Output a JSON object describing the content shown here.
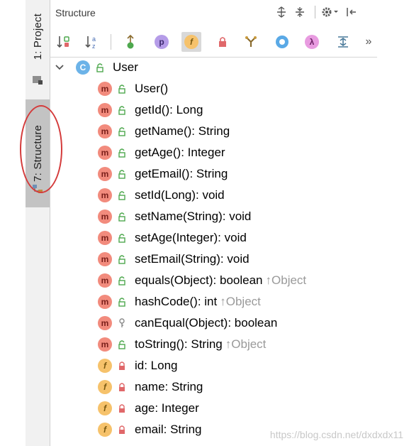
{
  "sidebar": {
    "project_tab": "1: Project",
    "structure_tab": "7: Structure"
  },
  "panel": {
    "title": "Structure"
  },
  "toolbar": {
    "buttons": [
      {
        "icon": "sort-by-visibility-icon",
        "active": false
      },
      {
        "icon": "sort-alphabetically-icon",
        "active": false
      },
      {
        "icon": "show-inherited-icon",
        "active": false
      },
      {
        "icon": "show-properties-icon",
        "label": "p",
        "active": false
      },
      {
        "icon": "show-fields-icon",
        "label": "f",
        "active": true
      },
      {
        "icon": "show-non-public-icon",
        "active": false
      },
      {
        "icon": "group-methods-icon",
        "active": false
      },
      {
        "icon": "show-anonymous-classes-icon",
        "active": false
      },
      {
        "icon": "show-lambdas-icon",
        "label": "λ",
        "active": false
      },
      {
        "icon": "expand-all-icon",
        "active": false
      },
      {
        "icon": "more-icon",
        "label": "»",
        "active": false
      }
    ]
  },
  "tree": {
    "class": {
      "badge": "C",
      "name": "User"
    },
    "members": [
      {
        "kind": "m",
        "visibility": "public",
        "text": "User()",
        "inherited": ""
      },
      {
        "kind": "m",
        "visibility": "public",
        "text": "getId(): Long",
        "inherited": ""
      },
      {
        "kind": "m",
        "visibility": "public",
        "text": "getName(): String",
        "inherited": ""
      },
      {
        "kind": "m",
        "visibility": "public",
        "text": "getAge(): Integer",
        "inherited": ""
      },
      {
        "kind": "m",
        "visibility": "public",
        "text": "getEmail(): String",
        "inherited": ""
      },
      {
        "kind": "m",
        "visibility": "public",
        "text": "setId(Long): void",
        "inherited": ""
      },
      {
        "kind": "m",
        "visibility": "public",
        "text": "setName(String): void",
        "inherited": ""
      },
      {
        "kind": "m",
        "visibility": "public",
        "text": "setAge(Integer): void",
        "inherited": ""
      },
      {
        "kind": "m",
        "visibility": "public",
        "text": "setEmail(String): void",
        "inherited": ""
      },
      {
        "kind": "m",
        "visibility": "public",
        "text": "equals(Object): boolean",
        "inherited": "↑Object"
      },
      {
        "kind": "m",
        "visibility": "public",
        "text": "hashCode(): int",
        "inherited": "↑Object"
      },
      {
        "kind": "m",
        "visibility": "protected",
        "text": "canEqual(Object): boolean",
        "inherited": ""
      },
      {
        "kind": "m",
        "visibility": "public",
        "text": "toString(): String",
        "inherited": "↑Object"
      },
      {
        "kind": "f",
        "visibility": "private",
        "text": "id: Long",
        "inherited": ""
      },
      {
        "kind": "f",
        "visibility": "private",
        "text": "name: String",
        "inherited": ""
      },
      {
        "kind": "f",
        "visibility": "private",
        "text": "age: Integer",
        "inherited": ""
      },
      {
        "kind": "f",
        "visibility": "private",
        "text": "email: String",
        "inherited": ""
      }
    ]
  },
  "watermark": "https://blog.csdn.net/dxdxdx11",
  "colors": {
    "method_badge": "#f28b7d",
    "class_badge": "#6cb3e8",
    "field_badge": "#f6c26b",
    "public_icon": "#4ea84e",
    "private_icon": "#e0686a",
    "annotation_ellipse": "#d43b3b"
  }
}
